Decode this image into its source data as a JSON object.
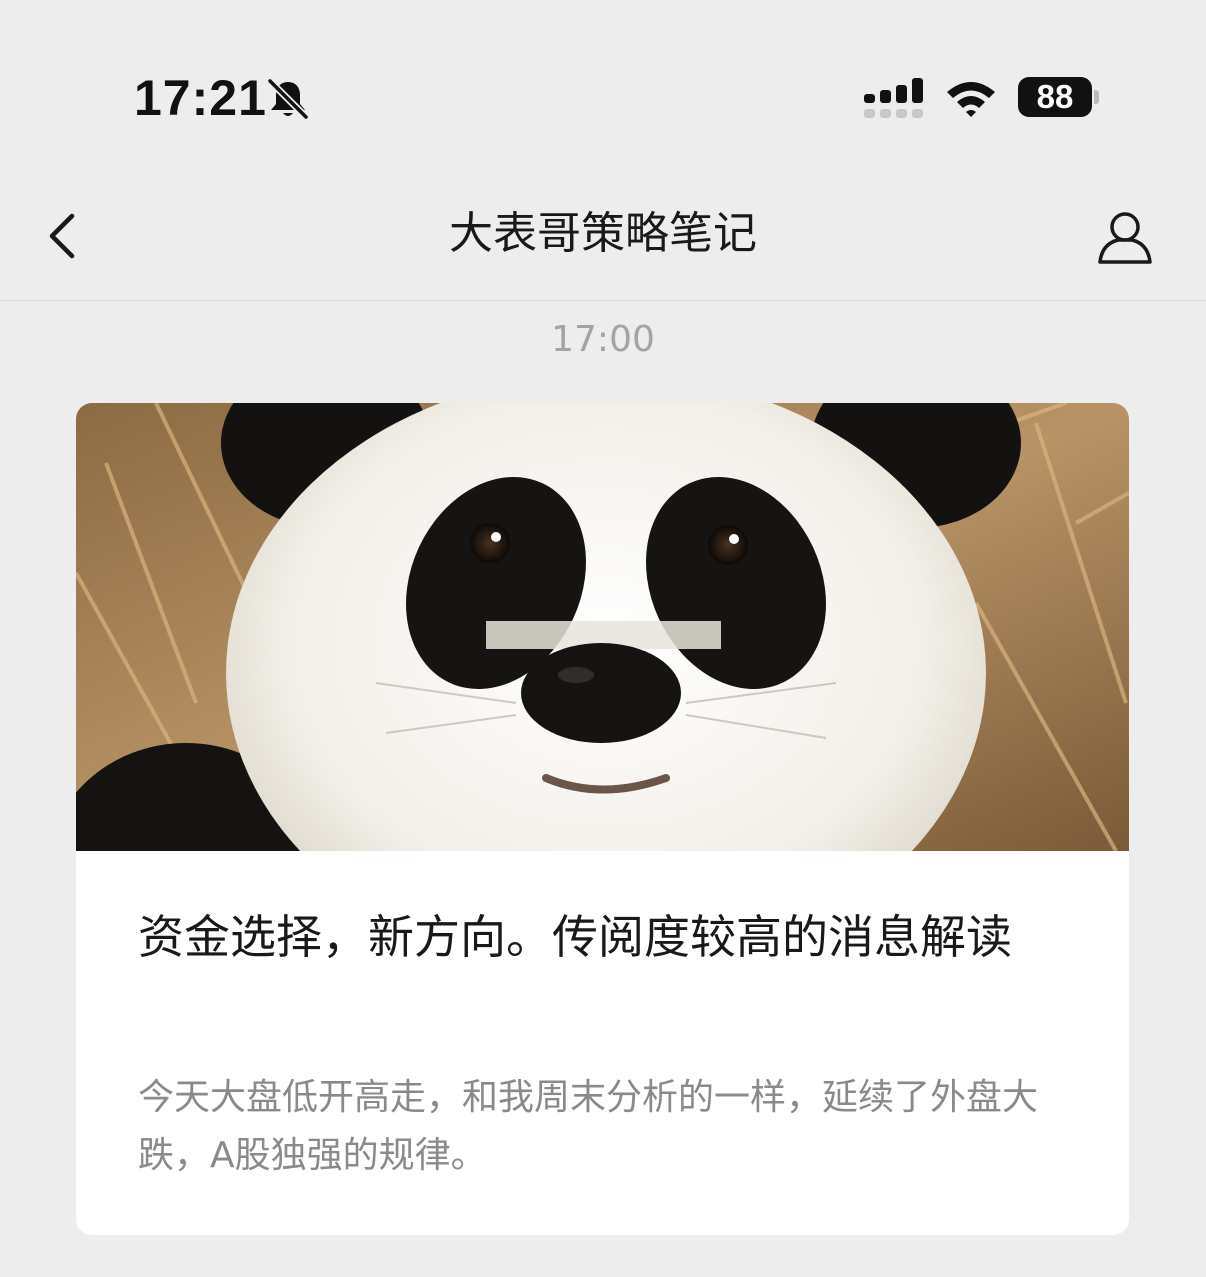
{
  "status_bar": {
    "time": "17:21",
    "battery": "88",
    "icons": [
      "bell-off-icon",
      "cellular-signal-icon",
      "wifi-icon",
      "battery-icon"
    ]
  },
  "nav": {
    "title": "大表哥策略笔记",
    "back_icon": "chevron-left-icon",
    "profile_icon": "person-icon"
  },
  "chat": {
    "timestamp": "17:00"
  },
  "article": {
    "cover_image": "panda close-up photo",
    "title": "资金选择，新方向。传阅度较高的消息解读",
    "summary": "今天大盘低开高走，和我周末分析的一样，延续了外盘大跌，A股独强的规律。"
  }
}
